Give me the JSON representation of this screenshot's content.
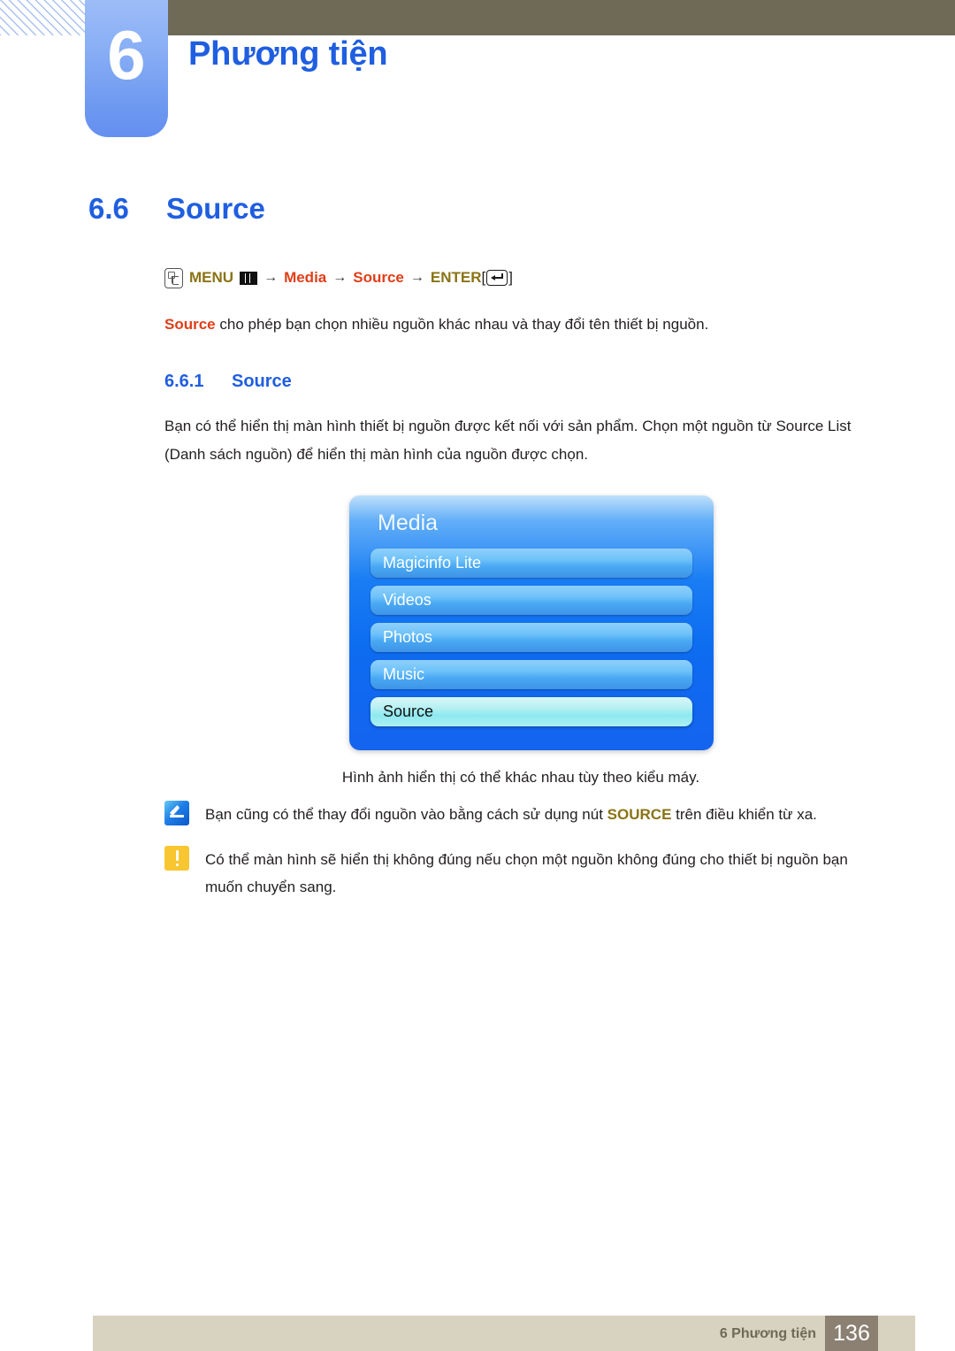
{
  "header": {
    "chapter_number": "6",
    "chapter_title": "Phương tiện",
    "accent_color": "#1f5ee0",
    "bar_color": "#6e6a56"
  },
  "section": {
    "number": "6.6",
    "title": "Source"
  },
  "menu_path": {
    "remote_icon": "remote-button-icon",
    "menu_label": "MENU",
    "menu_icon": "menu-bars-icon",
    "arrow": "→",
    "media_label": "Media",
    "source_label": "Source",
    "enter_label": "ENTER",
    "bracket_open": "[",
    "bracket_close": "]",
    "enter_icon": "enter-key-icon",
    "olive_color": "#8a7314",
    "red_color": "#e03e18"
  },
  "intro": {
    "lead": "Source",
    "rest": " cho phép bạn chọn nhiều nguồn khác nhau và thay đổi tên thiết bị nguồn."
  },
  "subsection": {
    "number": "6.6.1",
    "title": "Source"
  },
  "description": "Bạn có thể hiển thị màn hình thiết bị nguồn được kết nối với sản phẩm. Chọn một nguồn từ Source List (Danh sách nguồn) để hiển thị màn hình của nguồn được chọn.",
  "osd": {
    "title": "Media",
    "items": [
      {
        "label": "Magicinfo Lite",
        "selected": false
      },
      {
        "label": "Videos",
        "selected": false
      },
      {
        "label": "Photos",
        "selected": false
      },
      {
        "label": "Music",
        "selected": false
      },
      {
        "label": "Source",
        "selected": true
      }
    ],
    "panel_color": "#0d6cf0",
    "selected_color": "#b5f0f3"
  },
  "figure_caption": "Hình ảnh hiển thị có thể khác nhau tùy theo kiểu máy.",
  "notes": [
    {
      "icon": "note-pencil-icon",
      "text_before": "Bạn cũng có thể thay đổi nguồn vào bằng cách sử dụng nút ",
      "keyword": "SOURCE",
      "text_after": " trên điều khiển từ xa."
    },
    {
      "icon": "warning-exclamation-icon",
      "text_before": "Có thể màn hình sẽ hiển thị không đúng nếu chọn một nguồn không đúng cho thiết bị nguồn bạn muốn chuyển sang.",
      "keyword": "",
      "text_after": ""
    }
  ],
  "footer": {
    "label": "6 Phương tiện",
    "page_number": "136",
    "bar_color": "#d8d2c0",
    "page_box_color": "#8b8072"
  }
}
